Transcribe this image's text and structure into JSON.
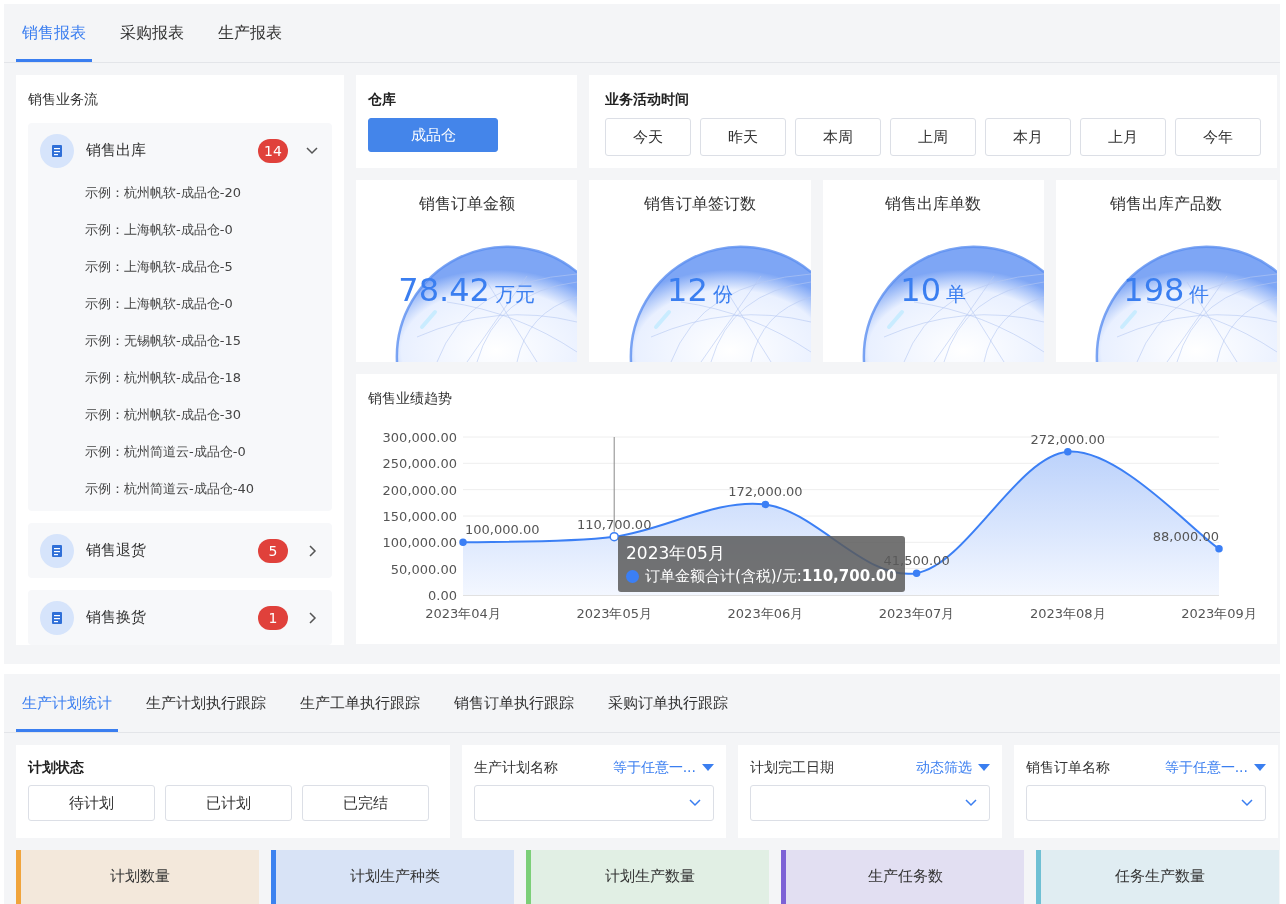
{
  "top_tabs": [
    {
      "label": "销售报表",
      "selected": true
    },
    {
      "label": "采购报表",
      "selected": false
    },
    {
      "label": "生产报表",
      "selected": false
    }
  ],
  "business_flow": {
    "title": "销售业务流",
    "groups": [
      {
        "label": "销售出库",
        "count": "14",
        "expanded": true,
        "children": [
          {
            "label": "示例：杭州帆软-成品仓-20"
          },
          {
            "label": "示例：上海帆软-成品仓-0"
          },
          {
            "label": "示例：上海帆软-成品仓-5"
          },
          {
            "label": "示例：上海帆软-成品仓-0"
          },
          {
            "label": "示例：无锡帆软-成品仓-15"
          },
          {
            "label": "示例：杭州帆软-成品仓-18"
          },
          {
            "label": "示例：杭州帆软-成品仓-30"
          },
          {
            "label": "示例：杭州简道云-成品仓-0"
          },
          {
            "label": "示例：杭州简道云-成品仓-40"
          }
        ]
      },
      {
        "label": "销售退货",
        "count": "5",
        "expanded": false
      },
      {
        "label": "销售换货",
        "count": "1",
        "expanded": false
      }
    ]
  },
  "warehouse": {
    "title": "仓库",
    "options": [
      {
        "label": "成品仓",
        "selected": true
      }
    ]
  },
  "activity_time": {
    "title": "业务活动时间",
    "options": [
      {
        "label": "今天",
        "selected": false
      },
      {
        "label": "昨天",
        "selected": false
      },
      {
        "label": "本周",
        "selected": false
      },
      {
        "label": "上周",
        "selected": false
      },
      {
        "label": "本月",
        "selected": false
      },
      {
        "label": "上月",
        "selected": false
      },
      {
        "label": "今年",
        "selected": false
      }
    ]
  },
  "kpis": [
    {
      "title": "销售订单金额",
      "value": "78.42",
      "unit": "万元"
    },
    {
      "title": "销售订单签订数",
      "value": "12",
      "unit": "份"
    },
    {
      "title": "销售出库单数",
      "value": "10",
      "unit": "单"
    },
    {
      "title": "销售出库产品数",
      "value": "198",
      "unit": "件"
    }
  ],
  "trend": {
    "title": "销售业绩趋势",
    "chart_data": {
      "type": "area",
      "categories": [
        "2023年04月",
        "2023年05月",
        "2023年06月",
        "2023年07月",
        "2023年08月",
        "2023年09月"
      ],
      "series": [
        {
          "name": "订单金额合计(含税)/元",
          "color": "#3b7ff5",
          "values": [
            100000,
            110700,
            172000,
            41500,
            272000,
            88000
          ]
        }
      ],
      "ylim": [
        0,
        300000
      ],
      "grid": true,
      "ref_lines": [
        {
          "axis": "x",
          "value": "2023年05月"
        }
      ],
      "yticks": [
        {
          "value": 0,
          "label": "0.00"
        },
        {
          "value": 50000,
          "label": "50,000.00"
        },
        {
          "value": 100000,
          "label": "100,000.00"
        },
        {
          "value": 150000,
          "label": "150,000.00"
        },
        {
          "value": 200000,
          "label": "200,000.00"
        },
        {
          "value": 250000,
          "label": "250,000.00"
        },
        {
          "value": 300000,
          "label": "300,000.00"
        }
      ],
      "value_labels": [
        "100,000.00",
        "110,700.00",
        "172,000.00",
        "41,500.00",
        "272,000.00",
        "88,000.00"
      ]
    },
    "tooltip": {
      "title": "2023年05月",
      "value": ":**110,700.00**"
    }
  },
  "bottom_tabs": [
    {
      "label": "生产计划统计",
      "selected": true
    },
    {
      "label": "生产计划执行跟踪",
      "selected": false
    },
    {
      "label": "生产工单执行跟踪",
      "selected": false
    },
    {
      "label": "销售订单执行跟踪",
      "selected": false
    },
    {
      "label": "采购订单执行跟踪",
      "selected": false
    }
  ],
  "plan_status": {
    "title": "计划状态",
    "options": [
      {
        "label": "待计划",
        "selected": false
      },
      {
        "label": "已计划",
        "selected": false
      },
      {
        "label": "已完结",
        "selected": false
      }
    ]
  },
  "filters": [
    {
      "label": "生产计划名称",
      "mode": "等于任意一..."
    },
    {
      "label": "计划完工日期",
      "mode": "动态筛选"
    },
    {
      "label": "销售订单名称",
      "mode": "等于任意一..."
    }
  ],
  "stat_cards": [
    {
      "label": "计划数量",
      "color": "#f0a43c"
    },
    {
      "label": "计划生产种类",
      "color": "#3b82f0"
    },
    {
      "label": "计划生产数量",
      "color": "#7ccf78"
    },
    {
      "label": "生产任务数",
      "color": "#7d62d6"
    },
    {
      "label": "任务生产数量",
      "color": "#6fc0d4"
    }
  ]
}
